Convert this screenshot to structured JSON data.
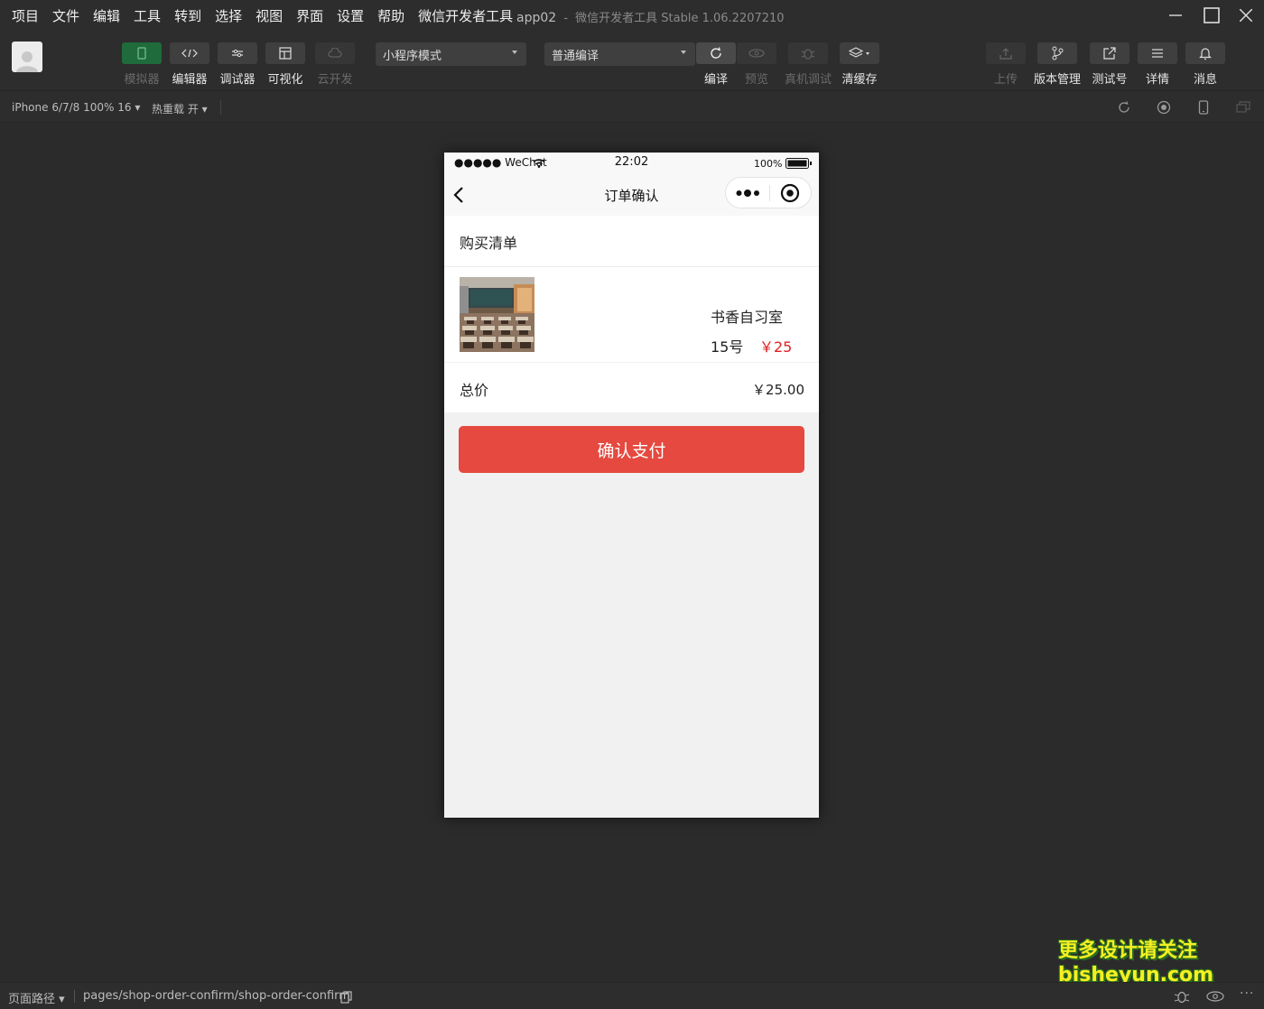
{
  "menubar": {
    "items": [
      "项目",
      "文件",
      "编辑",
      "工具",
      "转到",
      "选择",
      "视图",
      "界面",
      "设置",
      "帮助",
      "微信开发者工具"
    ],
    "title_app": "app02",
    "title_sep": "-",
    "title_rest": "微信开发者工具 Stable 1.06.2207210"
  },
  "toolbar": {
    "simulator": "模拟器",
    "editor": "编辑器",
    "debugger": "调试器",
    "visual": "可视化",
    "cloud": "云开发",
    "mode_select": "小程序模式",
    "compile_select": "普通编译",
    "compile": "编译",
    "preview": "预览",
    "real_debug": "真机调试",
    "clear_cache": "清缓存",
    "upload": "上传",
    "version": "版本管理",
    "test_id": "测试号",
    "details": "详情",
    "messages": "消息"
  },
  "subbar": {
    "device": "iPhone 6/7/8 100% 16",
    "hot_reload": "热重载 开"
  },
  "phone": {
    "status": {
      "carrier": "●●●●● WeChat",
      "time": "22:02",
      "battery": "100%"
    },
    "nav_title": "订单确认",
    "list_title": "购买清单",
    "item": {
      "name": "书香自习室",
      "seat": "15号",
      "price": "￥25"
    },
    "total_label": "总价",
    "total_value": "￥25.00",
    "pay_button": "确认支付"
  },
  "bottombar": {
    "page_path_label": "页面路径",
    "page_path": "pages/shop-order-confirm/shop-order-confirm"
  },
  "watermark": {
    "line1": "更多设计请关注",
    "line2": "bisheyun.com"
  },
  "colors": {
    "accent_green": "#1f6b3b",
    "pay_red": "#e5493f",
    "price_red": "#e02020"
  }
}
